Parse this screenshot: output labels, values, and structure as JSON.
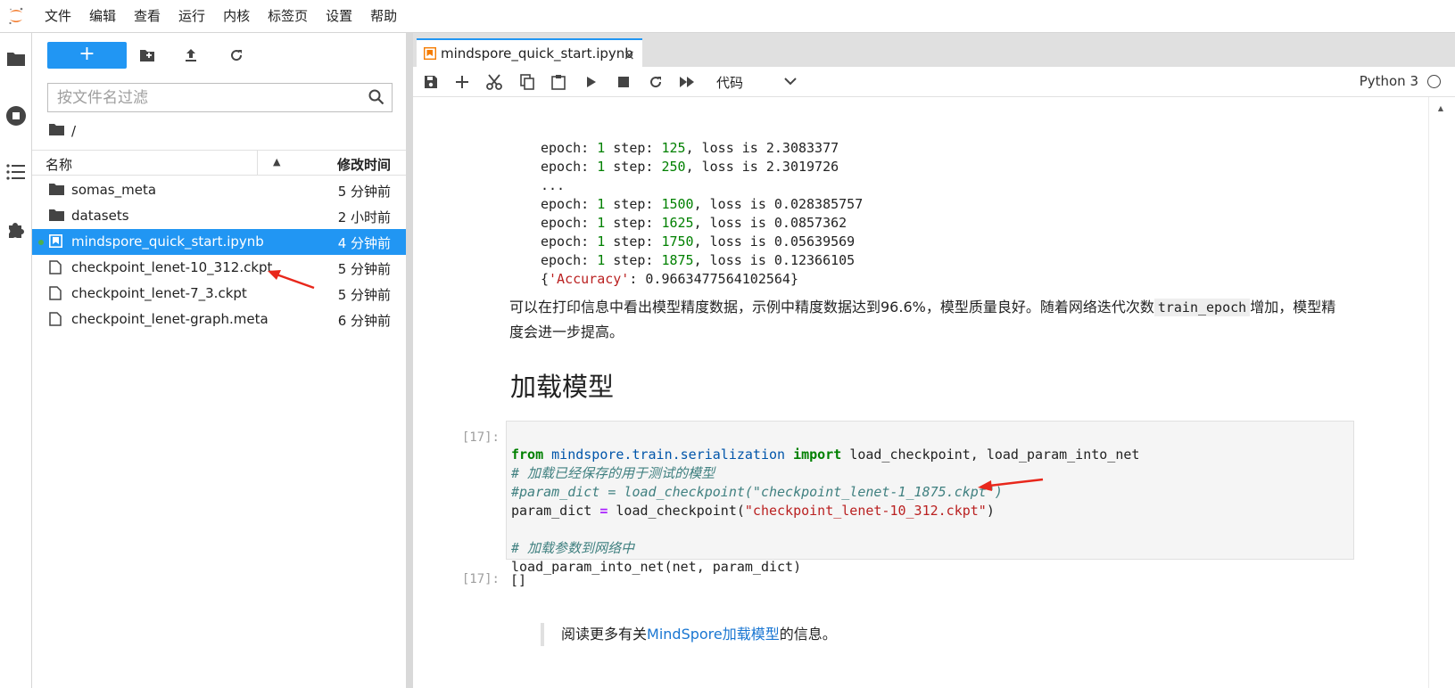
{
  "menu": [
    "文件",
    "编辑",
    "查看",
    "运行",
    "内核",
    "标签页",
    "设置",
    "帮助"
  ],
  "filebrowser": {
    "new_label": "+",
    "filter_placeholder": "按文件名过滤",
    "breadcrumb": "/",
    "columns": {
      "name": "名称",
      "modified": "修改时间"
    },
    "files": [
      {
        "name": "somas_meta",
        "time": "5 分钟前",
        "kind": "folder"
      },
      {
        "name": "datasets",
        "time": "2 小时前",
        "kind": "folder"
      },
      {
        "name": "mindspore_quick_start.ipynb",
        "time": "4 分钟前",
        "kind": "notebook",
        "selected": true,
        "running": true
      },
      {
        "name": "checkpoint_lenet-10_312.ckpt",
        "time": "5 分钟前",
        "kind": "file"
      },
      {
        "name": "checkpoint_lenet-7_3.ckpt",
        "time": "5 分钟前",
        "kind": "file"
      },
      {
        "name": "checkpoint_lenet-graph.meta",
        "time": "6 分钟前",
        "kind": "file"
      }
    ]
  },
  "tab": {
    "title": "mindspore_quick_start.ipynb",
    "close": "×"
  },
  "toolbar": {
    "cell_type": "代码",
    "kernel": "Python 3"
  },
  "output": {
    "step_lines": [
      {
        "epoch": "1",
        "step": "125",
        "loss": "2.3083377"
      },
      {
        "epoch": "1",
        "step": "250",
        "loss": "2.3019726"
      },
      {
        "ellipsis": "..."
      },
      {
        "epoch": "1",
        "step": "1500",
        "loss": "0.028385757"
      },
      {
        "epoch": "1",
        "step": "1625",
        "loss": "0.0857362"
      },
      {
        "epoch": "1",
        "step": "1750",
        "loss": "0.05639569"
      },
      {
        "epoch": "1",
        "step": "1875",
        "loss": "0.12366105"
      }
    ],
    "accuracy_key": "'Accuracy'",
    "accuracy_value": "0.9663477564102564"
  },
  "markdown": {
    "para_part1": "可以在打印信息中看出模型精度数据，示例中精度数据达到96.6%，模型质量良好。随着网络迭代次数",
    "inline_code": "train_epoch",
    "para_part2": "增加，模型精度会进一步提高。",
    "heading": "加载模型"
  },
  "code_cell": {
    "prompt": "[17]:",
    "kw_from": "from",
    "module": "mindspore.train.serialization",
    "kw_import": "import",
    "imports": "load_checkpoint, load_param_into_net",
    "comment1": "# 加载已经保存的用于测试的模型",
    "comment2": "#param_dict = load_checkpoint(\"checkpoint_lenet-1_1875.ckpt\")",
    "assign_var": "param_dict",
    "assign_op": "=",
    "assign_call": "load_checkpoint(",
    "assign_str": "\"checkpoint_lenet-10_312.ckpt\"",
    "assign_close": ")",
    "comment3": "# 加载参数到网络中",
    "last_line": "load_param_into_net(net, param_dict)"
  },
  "output_cell": {
    "prompt": "[17]:",
    "value": "[]"
  },
  "blockquote": {
    "before": "阅读更多有关",
    "link": "MindSpore加载模型",
    "after": "的信息。"
  }
}
